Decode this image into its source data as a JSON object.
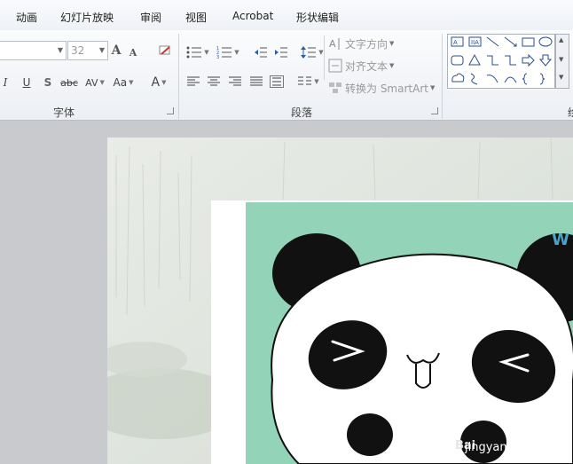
{
  "tabs": [
    "动画",
    "幻灯片放映",
    "审阅",
    "视图",
    "Acrobat",
    "形状编辑"
  ],
  "font_group": {
    "size_value": "32",
    "label": "字体",
    "grow_font": "A",
    "shrink_font": "A",
    "italic": "I",
    "underline": "U",
    "shadow": "S",
    "strikethrough": "abc",
    "char_spacing": "AV",
    "change_case": "Aa",
    "font_color": "A"
  },
  "paragraph_group": {
    "label": "段落",
    "text_direction": "文字方向",
    "align_text": "对齐文本",
    "convert_smartart": "转换为 SmartArt"
  },
  "drawing_group": {
    "label_partial": "绘"
  },
  "watermark": "jingyan.baidu.com",
  "watermark_prefix": "Bai",
  "colors": {
    "slide_green": "#93d4b8",
    "panda_black": "#111111"
  }
}
